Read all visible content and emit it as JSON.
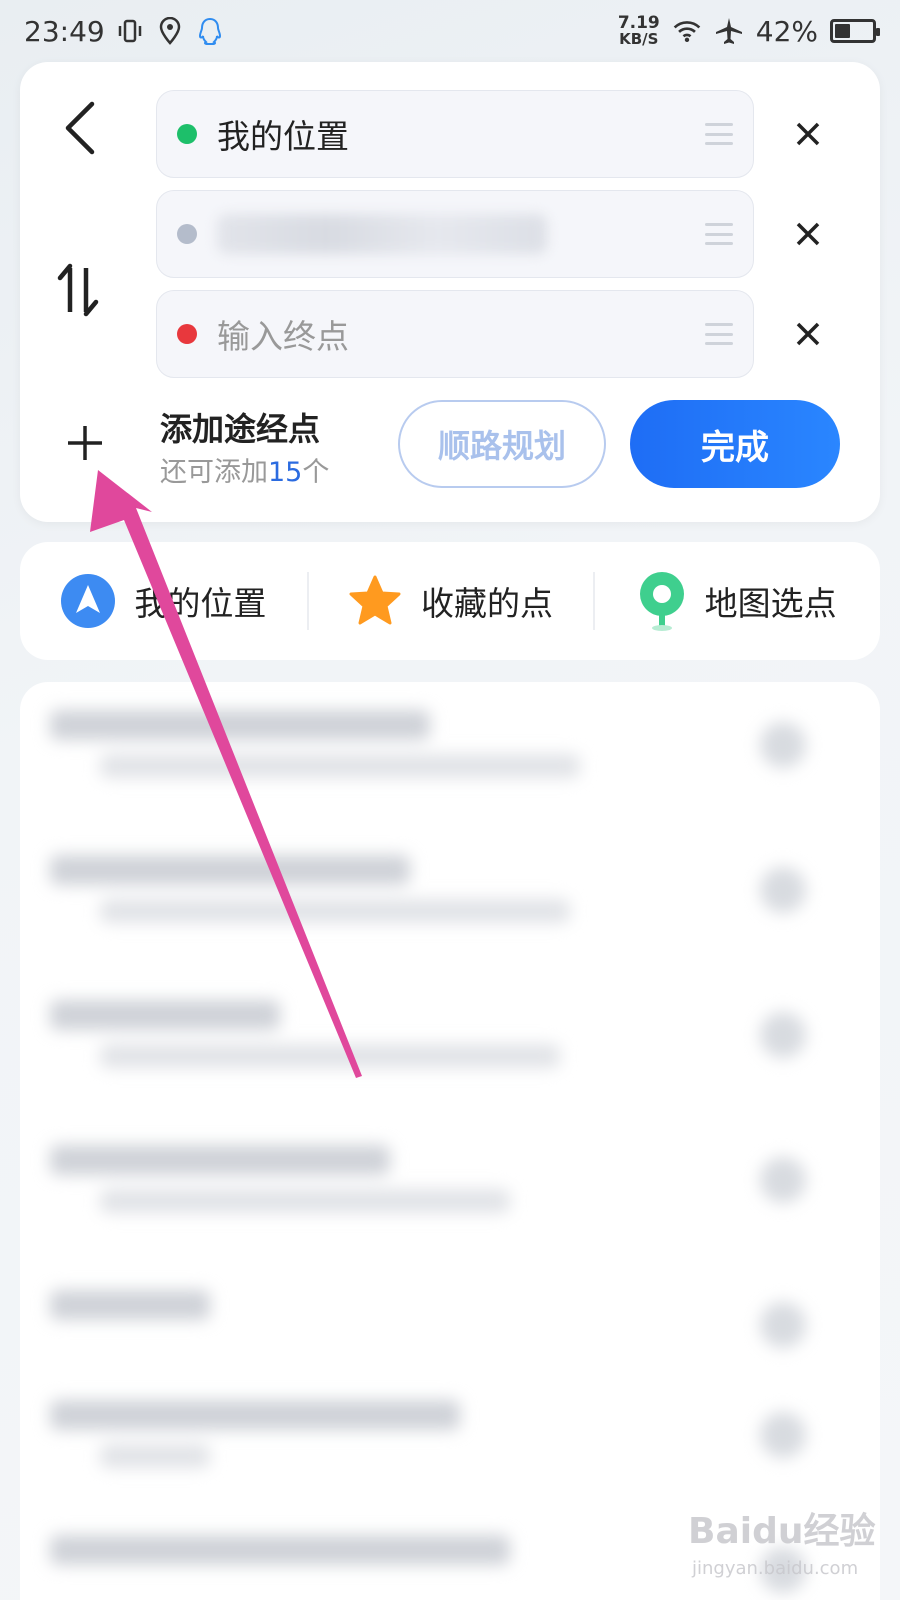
{
  "status_bar": {
    "time": "23:49",
    "net_speed_value": "7.19",
    "net_speed_unit": "KB/S",
    "battery": "42%",
    "battery_level": 0.42,
    "icons": [
      "vibrate-icon",
      "location-icon",
      "qq-icon",
      "wifi-icon",
      "airplane-icon",
      "battery-icon"
    ]
  },
  "route": {
    "start": {
      "text": "我的位置",
      "dot_color": "#1dbf6a"
    },
    "via": {
      "text": "",
      "dot_color": "#b4bccb"
    },
    "end": {
      "placeholder": "输入终点",
      "dot_color": "#e8383d"
    }
  },
  "add_waypoint": {
    "title": "添加途经点",
    "sub_prefix": "还可添加",
    "sub_count": "15",
    "sub_suffix": "个"
  },
  "buttons": {
    "plan_label": "顺路规划",
    "done_label": "完成"
  },
  "quick_picks": [
    {
      "label": "我的位置",
      "icon": "navigation-arrow-icon",
      "color": "#3d8bf2"
    },
    {
      "label": "收藏的点",
      "icon": "star-icon",
      "color": "#ff9a1f"
    },
    {
      "label": "地图选点",
      "icon": "map-pin-icon",
      "color": "#3fcf8e"
    }
  ],
  "watermark": {
    "main": "Baidu经验",
    "sub": "jingyan.baidu.com"
  },
  "colors": {
    "accent": "#1e6df5",
    "annotation_arrow": "#e0489c"
  }
}
